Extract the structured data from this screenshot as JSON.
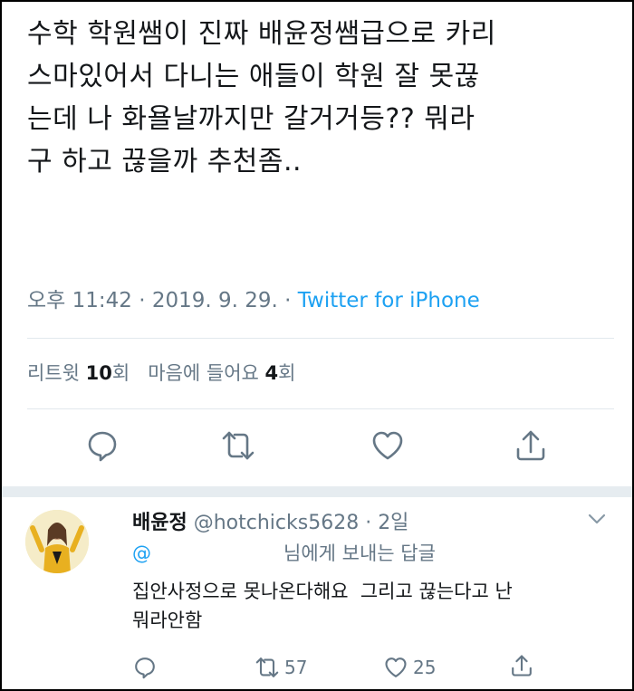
{
  "tweet": {
    "text": "수학 학원쌤이 진짜 배윤정쌤급으로 카리\n스마있어서 다니는 애들이 학원 잘 못끊\n는데 나 화욜날까지만 갈거거등?? 뭐라\n구 하고 끊을까 추천좀..",
    "time": "오후 11:42",
    "date": "2019. 9. 29.",
    "separator": "·",
    "source": "Twitter for iPhone",
    "retweets_label": "리트윗",
    "retweets_count": "10",
    "retweets_unit": "회",
    "likes_label": "마음에 들어요",
    "likes_count": "4",
    "likes_unit": "회"
  },
  "icons": {
    "reply": "reply-icon",
    "retweet": "retweet-icon",
    "like": "heart-icon",
    "share": "share-icon",
    "menu": "chevron-down-icon"
  },
  "colors": {
    "text": "#14171a",
    "muted": "#657786",
    "link": "#1da1f2",
    "divider": "#e1e8ed",
    "separator_bg": "#e6ecf0"
  },
  "reply": {
    "display_name": "배윤정",
    "handle": "@hotchicks5628",
    "age": "· 2일",
    "replying_at": "@",
    "replying_suffix": "님에게 보내는 답글",
    "text": "집안사정으로 못나온다해요  그리고 끊는다고 난\n뭐라안함",
    "retweet_count": "57",
    "like_count": "25"
  }
}
